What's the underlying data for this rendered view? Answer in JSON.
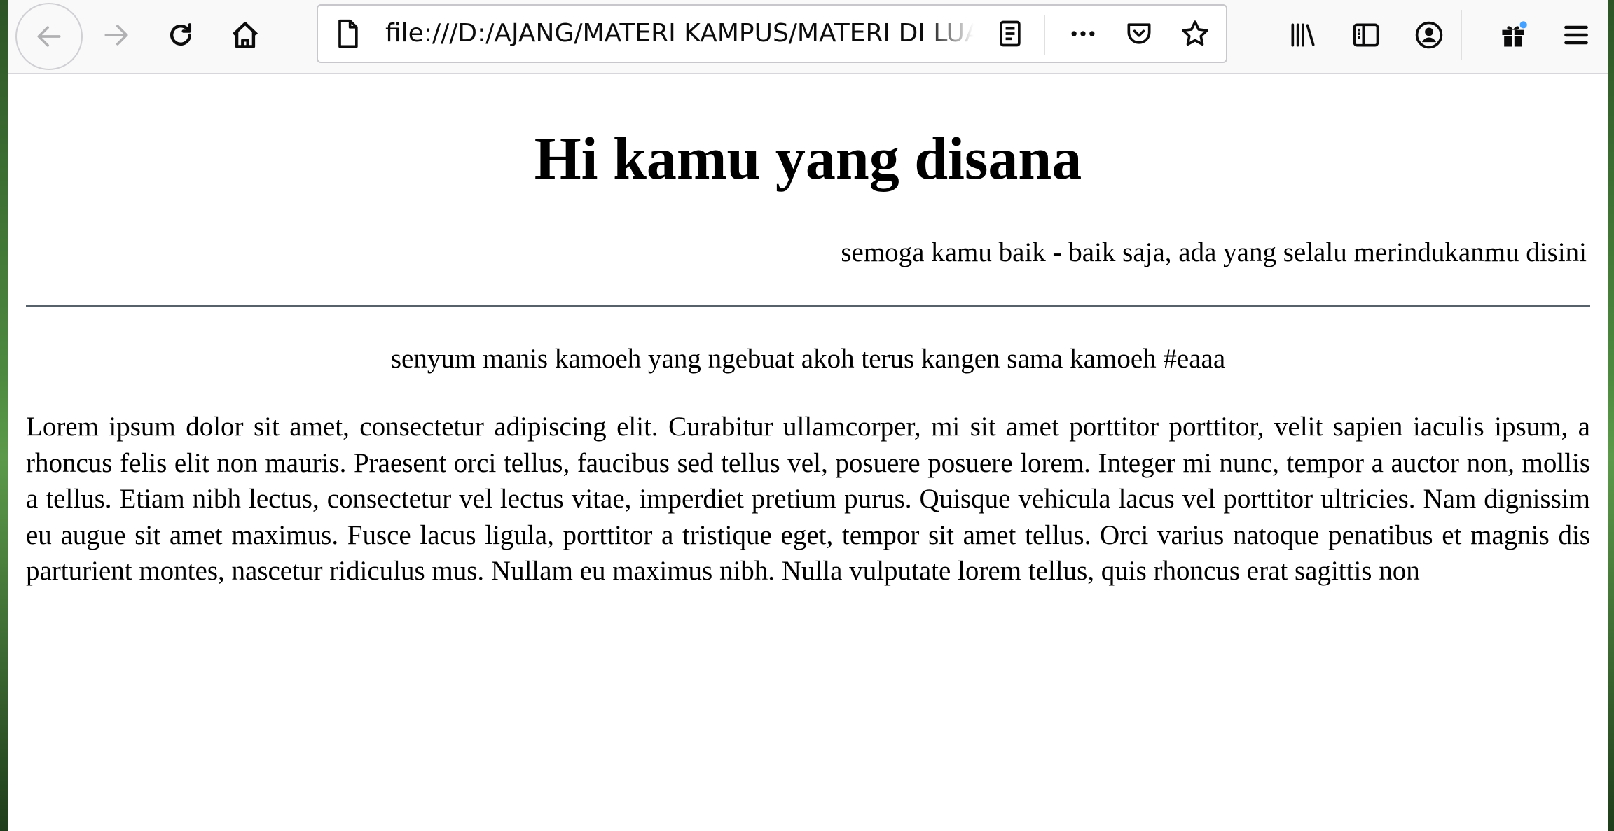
{
  "browser": {
    "url": "file:///D:/AJANG/MATERI KAMPUS/MATERI DI LUAR/index.html",
    "icons": [
      "arrow-left-icon",
      "arrow-right-icon",
      "reload-icon",
      "home-icon",
      "page-icon",
      "reader-view-icon",
      "more-icon",
      "pocket-icon",
      "star-icon",
      "library-icon",
      "sidebar-icon",
      "account-icon",
      "gift-icon",
      "menu-icon"
    ],
    "notification_dot_color": "#45a1ff"
  },
  "page": {
    "title": "Hi kamu yang disana",
    "subtitle": "semoga kamu baik - baik saja, ada yang selalu merindukanmu disini",
    "quote": "senyum manis kamoeh yang ngebuat akoh terus kangen sama kamoeh #eaaa",
    "paragraph": "Lorem ipsum dolor sit amet, consectetur adipiscing elit. Curabitur ullamcorper, mi sit amet porttitor porttitor, velit sapien iaculis ipsum, a rhoncus felis elit non mauris. Praesent orci tellus, faucibus sed tellus vel, posuere posuere lorem. Integer mi nunc, tempor a auctor non, mollis a tellus. Etiam nibh lectus, consectetur vel lectus vitae, imperdiet pretium purus. Quisque vehicula lacus vel porttitor ultricies. Nam dignissim eu augue sit amet maximus. Fusce lacus ligula, porttitor a tristique eget, tempor sit amet tellus. Orci varius natoque penatibus et magnis dis parturient montes, nascetur ridiculus mus. Nullam eu maximus nibh. Nulla vulputate lorem tellus, quis rhoncus erat sagittis non",
    "divider_color": "#56616a"
  }
}
